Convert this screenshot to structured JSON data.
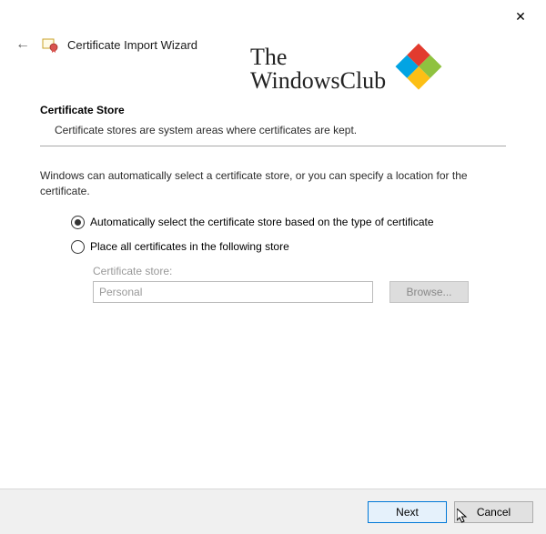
{
  "window": {
    "close_icon": "✕"
  },
  "header": {
    "back_icon": "←",
    "title": "Certificate Import Wizard"
  },
  "watermark": {
    "line1": "The",
    "line2": "WindowsClub"
  },
  "section": {
    "heading": "Certificate Store",
    "description": "Certificate stores are system areas where certificates are kept."
  },
  "body": {
    "intro": "Windows can automatically select a certificate store, or you can specify a location for the certificate.",
    "radio_auto": "Automatically select the certificate store based on the type of certificate",
    "radio_manual": "Place all certificates in the following store",
    "store_label": "Certificate store:",
    "store_value": "Personal",
    "browse_label": "Browse..."
  },
  "footer": {
    "next": "Next",
    "cancel": "Cancel"
  }
}
